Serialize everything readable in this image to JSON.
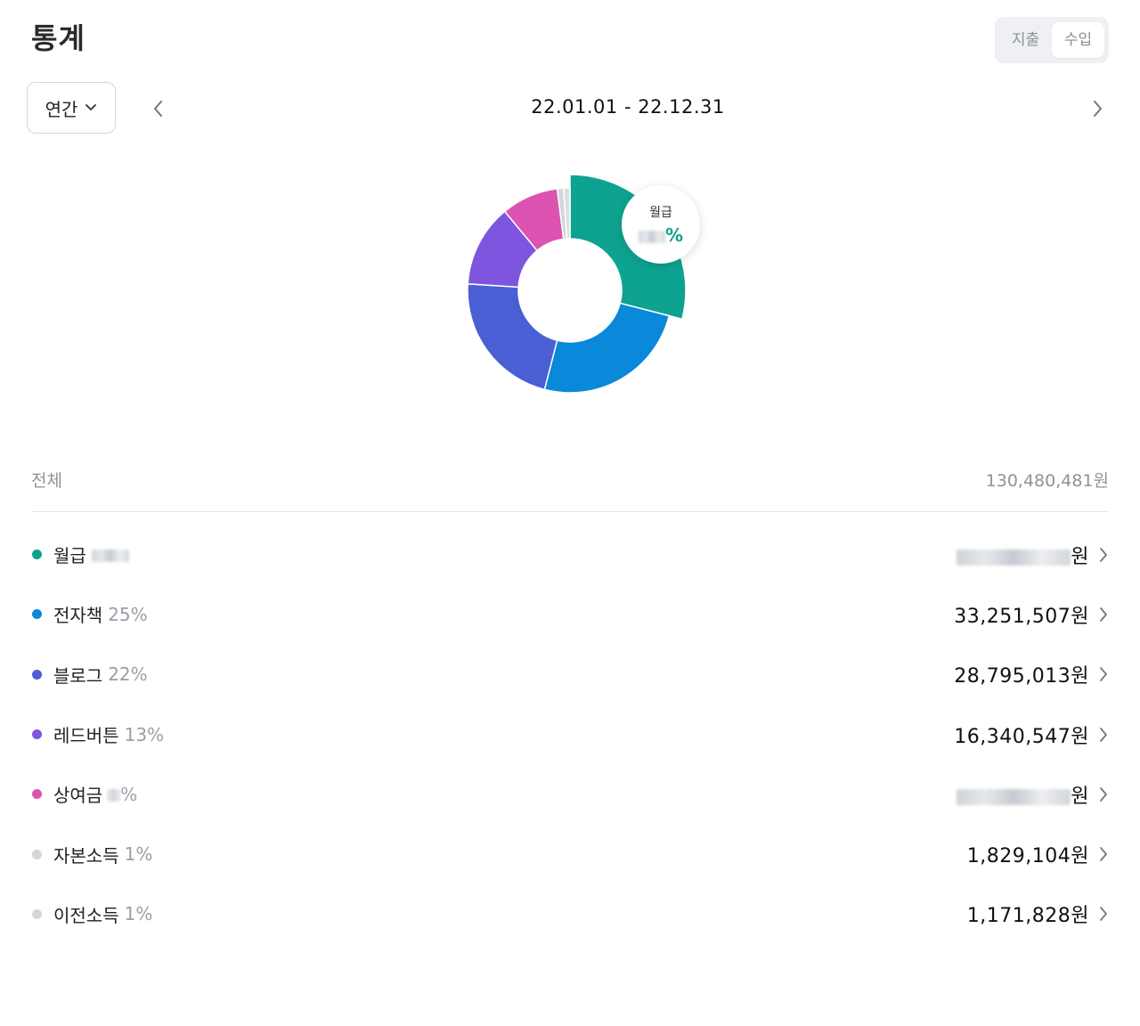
{
  "header": {
    "title": "통계"
  },
  "toggle": {
    "expense": "지출",
    "income": "수입",
    "active": "income"
  },
  "period": {
    "label": "연간",
    "range": "22.01.01 - 22.12.31"
  },
  "tooltip": {
    "label": "월급",
    "value_suffix": "%"
  },
  "summary": {
    "label": "전체",
    "total": "130,480,481원"
  },
  "colors": {
    "salary": "#0da390",
    "ebook": "#0a88d9",
    "blog": "#4a5fd4",
    "redbutton": "#7e55de",
    "bonus": "#dc53b1",
    "capital": "#d3d6da",
    "transfer": "#dcdfe2"
  },
  "items": [
    {
      "name": "월급",
      "pct": "",
      "amount": "",
      "color": "#0da390",
      "masked": true
    },
    {
      "name": "전자책",
      "pct": "25%",
      "amount": "33,251,507원",
      "color": "#0a88d9",
      "masked": false
    },
    {
      "name": "블로그",
      "pct": "22%",
      "amount": "28,795,013원",
      "color": "#4a5fd4",
      "masked": false
    },
    {
      "name": "레드버튼",
      "pct": "13%",
      "amount": "16,340,547원",
      "color": "#7e55de",
      "masked": false
    },
    {
      "name": "상여금",
      "pct": "%",
      "amount": "원",
      "color": "#dc53b1",
      "masked": true
    },
    {
      "name": "자본소득",
      "pct": "1%",
      "amount": "1,829,104원",
      "color": "#d3d6da",
      "masked": false
    },
    {
      "name": "이전소득",
      "pct": "1%",
      "amount": "1,171,828원",
      "color": "#d3d6da",
      "masked": false
    }
  ],
  "chart_data": {
    "type": "pie",
    "donut": true,
    "categories": [
      "월급",
      "전자책",
      "블로그",
      "레드버튼",
      "상여금",
      "자본소득",
      "이전소득"
    ],
    "values": [
      29,
      25,
      22,
      13,
      9,
      1,
      1
    ],
    "colors": [
      "#0da390",
      "#0a88d9",
      "#4a5fd4",
      "#7e55de",
      "#dc53b1",
      "#d3d6da",
      "#dcdfe2"
    ],
    "highlighted": "월급"
  }
}
